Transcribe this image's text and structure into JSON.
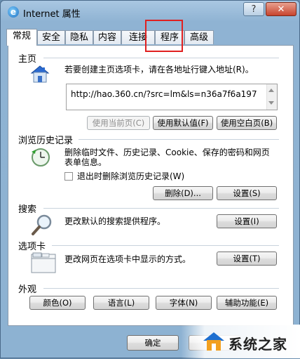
{
  "window": {
    "title": "Internet 属性",
    "help_label": "?",
    "close_label": "✕"
  },
  "tabs": [
    "常规",
    "安全",
    "隐私",
    "内容",
    "连接",
    "程序",
    "高级"
  ],
  "home": {
    "section_label": "主页",
    "description": "若要创建主页选项卡，请在各地址行键入地址(R)。",
    "url": "http://hao.360.cn/?src=lm&ls=n36a7f6a197",
    "btn_current": "使用当前页(C)",
    "btn_default": "使用默认值(F)",
    "btn_blank": "使用空白页(B)"
  },
  "history": {
    "section_label": "浏览历史记录",
    "description_line1": "删除临时文件、历史记录、Cookie、保存的密码和网页",
    "description_line2": "表单信息。",
    "checkbox_label": "退出时删除浏览历史记录(W)",
    "btn_delete": "删除(D)...",
    "btn_settings": "设置(S)"
  },
  "search": {
    "section_label": "搜索",
    "description": "更改默认的搜索提供程序。",
    "btn_settings": "设置(I)"
  },
  "tabs_section": {
    "section_label": "选项卡",
    "description": "更改网页在选项卡中显示的方式。",
    "btn_settings": "设置(T)"
  },
  "appearance": {
    "section_label": "外观",
    "btn_colors": "颜色(O)",
    "btn_languages": "语言(L)",
    "btn_fonts": "字体(N)",
    "btn_accessibility": "辅助功能(E)"
  },
  "footer": {
    "ok_label": "确定"
  },
  "watermark": {
    "text": "系统之家"
  }
}
